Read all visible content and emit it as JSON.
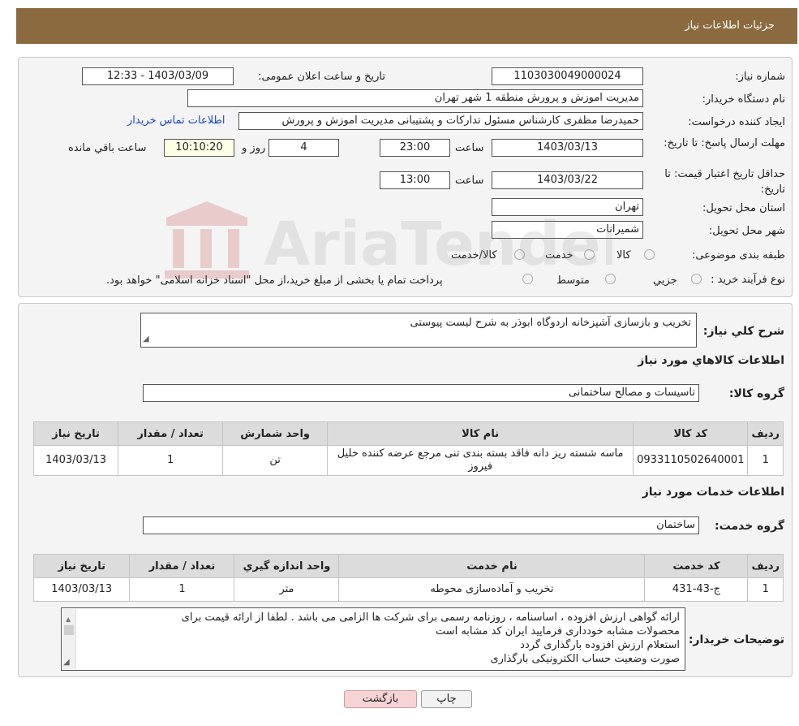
{
  "header": {
    "title": "جزئیات اطلاعات نیاز"
  },
  "fields": {
    "need_number_label": "شماره نیاز:",
    "need_number": "1103030049000024",
    "announce_label": "تاریخ و ساعت اعلان عمومی:",
    "announce_value": "1403/03/09 - 12:33",
    "buyer_label": "نام دستگاه خریدار:",
    "buyer_value": "مدیریت اموزش و پرورش منطقه 1 شهر تهران",
    "creator_label": "ایجاد کننده درخواست:",
    "creator_value": "حمیدرضا مظفری کارشناس مسئول تدارکات و پشتیبانی مدیریت اموزش و پرورش",
    "contact_link": "اطلاعات تماس خریدار",
    "deadline_label": "مهلت ارسال پاسخ: تا تاریخ:",
    "deadline_date": "1403/03/13",
    "time_label": "ساعت",
    "deadline_time": "23:00",
    "days_value": "4",
    "days_label": "روز و",
    "remaining_time": "10:10:20",
    "remaining_label": "ساعت باقي مانده",
    "validity_label": "حداقل تاریخ اعتبار قیمت: تا تاریخ:",
    "validity_date": "1403/03/22",
    "validity_time": "13:00",
    "province_label": "استان محل تحویل:",
    "province_value": "تهران",
    "city_label": "شهر محل تحویل:",
    "city_value": "شمیرانات",
    "category_label": "طبقه بندی موضوعی:",
    "category_options": [
      "کالا",
      "خدمت",
      "کالا/خدمت"
    ],
    "process_label": "نوع فرآیند خرید :",
    "process_options": [
      "جزیي",
      "متوسط"
    ],
    "process_note": "پرداخت تمام یا بخشی از مبلغ خرید،از محل \"اسناد خزانه اسلامی\" خواهد بود."
  },
  "description": {
    "label": "شرح کلي نياز:",
    "value": "تخریب و بازسازی آشپزخانه اردوگاه ابوذر به شرح لیست پیوستی"
  },
  "goods": {
    "title": "اطلاعات کالاهاي مورد نياز",
    "group_label": "گروه کالا:",
    "group_value": "تاسیسات و مصالح ساختمانی",
    "headers": [
      "رديف",
      "کد کالا",
      "نام کالا",
      "واحد شمارش",
      "تعداد / مقدار",
      "تاريخ نياز"
    ],
    "rows": [
      [
        "1",
        "0933110502640001",
        "ماسه شسته ریز دانه فاقد بسته بندی تنی مرجع عرضه کننده خلیل فیروز",
        "تن",
        "1",
        "1403/03/13"
      ]
    ]
  },
  "services": {
    "title": "اطلاعات خدمات مورد نياز",
    "group_label": "گروه خدمت:",
    "group_value": "ساختمان",
    "headers": [
      "رديف",
      "کد خدمت",
      "نام خدمت",
      "واحد اندازه گيري",
      "تعداد / مقدار",
      "تاريخ نياز"
    ],
    "rows": [
      [
        "1",
        "ج-43-431",
        "تخریب و آماده‌سازی محوطه",
        "متر",
        "1",
        "1403/03/13"
      ]
    ]
  },
  "buyer_notes": {
    "label": "توضیحات خریدار:",
    "lines": [
      "ارائه گواهی ارزش افزوده ، اساسنامه  ، روزنامه رسمی برای شرکت ها الزامی می باشد . لطفا از ارائه قیمت برای",
      "محصولات مشابه خودداری فرمایید ایران کد مشابه است",
      "استعلام ارزش افزوده بارگذاری گردد",
      "صورت وضعیت حساب الکترونیکی بارگذاری"
    ]
  },
  "buttons": {
    "print": "چاپ",
    "back": "بازگشت"
  },
  "watermark": {
    "text": "AriaTender.neT"
  }
}
